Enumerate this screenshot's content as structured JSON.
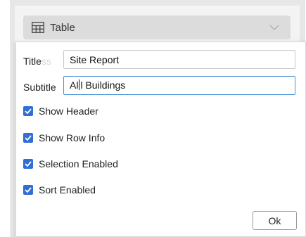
{
  "dropdown": {
    "label": "Table",
    "icon": "table-icon"
  },
  "form": {
    "title_label": "Title",
    "title_value": "Site Report",
    "subtitle_label": "Subtitle",
    "subtitle_value_before_cursor": "Al",
    "subtitle_value_after_cursor": "l Buildings"
  },
  "options": [
    {
      "label": "Show Header",
      "checked": true
    },
    {
      "label": "Show Row Info",
      "checked": true
    },
    {
      "label": "Selection Enabled",
      "checked": true
    },
    {
      "label": "Sort Enabled",
      "checked": true
    }
  ],
  "actions": {
    "ok_label": "Ok"
  },
  "colors": {
    "accent": "#2f6fd6",
    "focus_border": "#4a90d9"
  }
}
